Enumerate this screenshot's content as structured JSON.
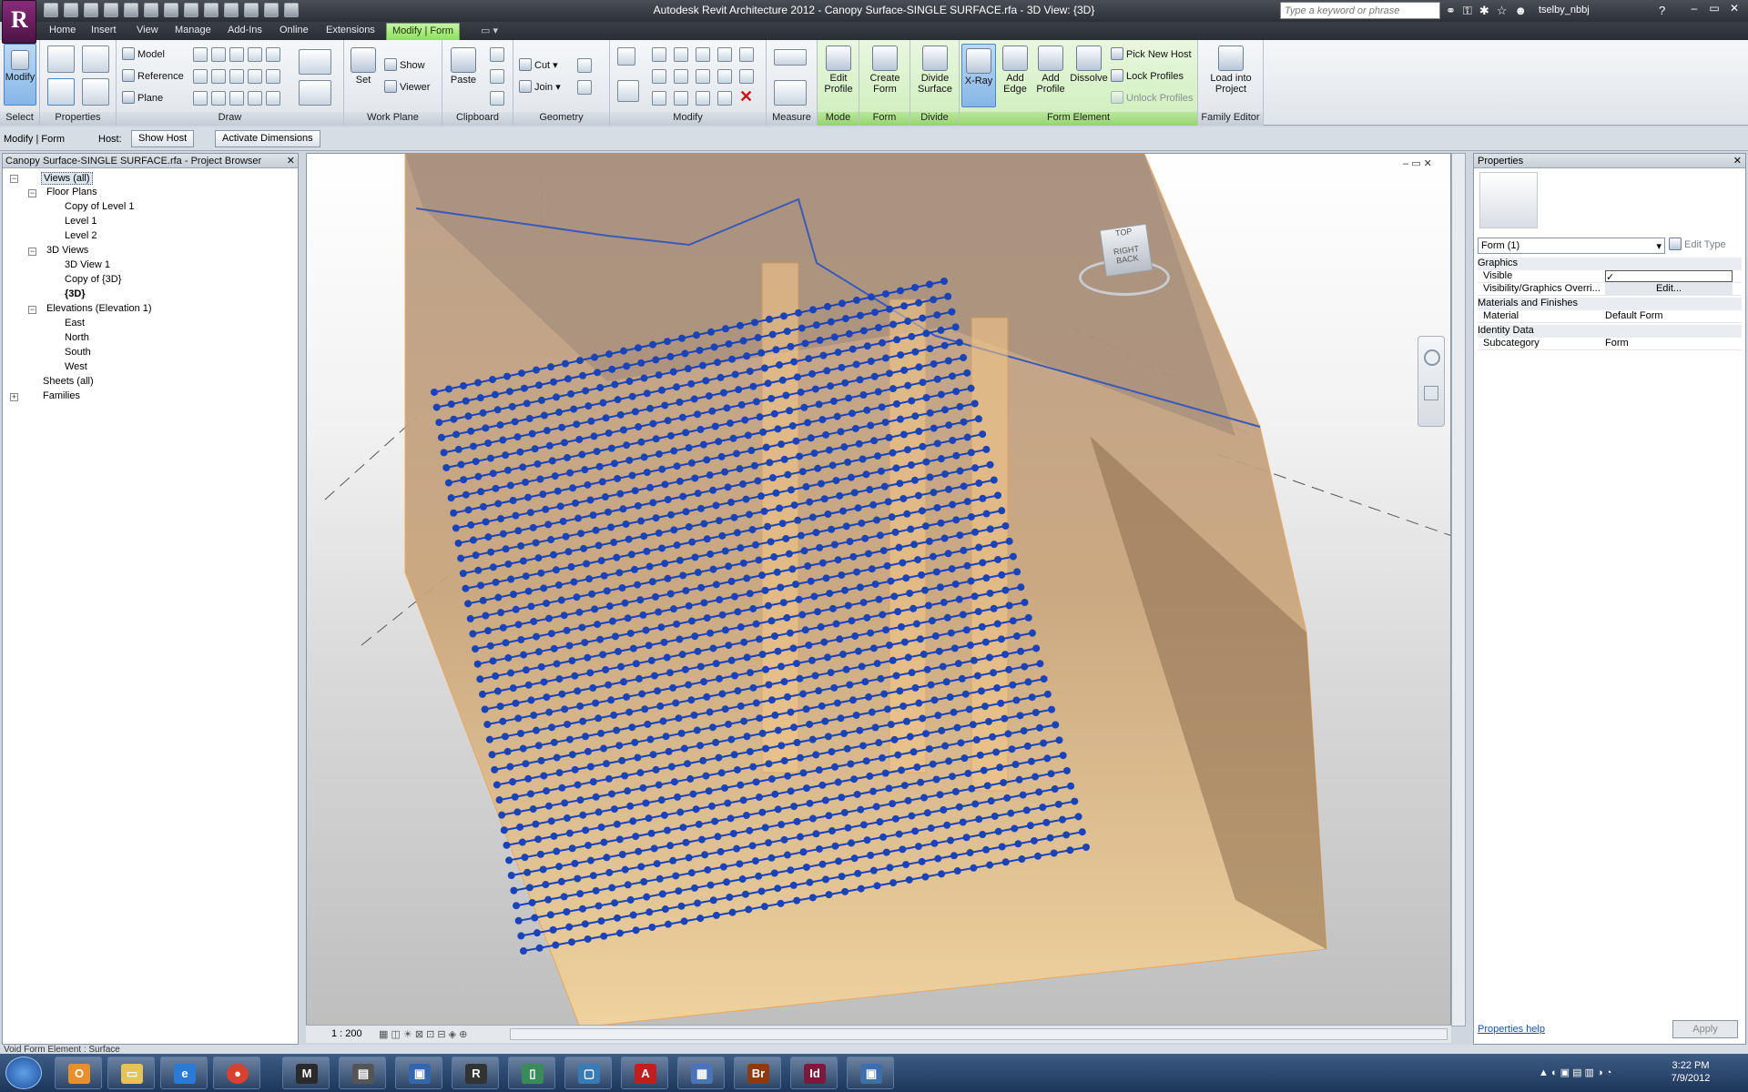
{
  "title_bar": {
    "app_button": "R",
    "title": "Autodesk Revit Architecture 2012 -  Canopy Surface-SINGLE SURFACE.rfa - 3D View: {3D}",
    "search_placeholder": "Type a keyword or phrase",
    "username": "tselby_nbbj",
    "help": "?",
    "minimize": "–",
    "restore": "▭",
    "close": "✕"
  },
  "tabs": [
    "Home",
    "Insert",
    "View",
    "Manage",
    "Add-Ins",
    "Online",
    "Extensions",
    "Modify | Form"
  ],
  "active_tab": "Modify | Form",
  "ribbon": {
    "panels": {
      "select": "Select",
      "properties": "Properties",
      "draw": "Draw",
      "work_plane": "Work Plane",
      "clipboard": "Clipboard",
      "geometry": "Geometry",
      "modify": "Modify",
      "measure": "Measure",
      "mode": "Mode",
      "form": "Form",
      "divide": "Divide",
      "form_element": "Form Element",
      "family_editor": "Family Editor"
    },
    "buttons": {
      "modify": "Modify",
      "model": "Model",
      "reference": "Reference",
      "plane": "Plane",
      "set": "Set",
      "show": "Show",
      "viewer": "Viewer",
      "paste": "Paste",
      "cut": "Cut",
      "join": "Join",
      "edit_profile": "Edit Profile",
      "create_form": "Create Form",
      "divide_surface": "Divide Surface",
      "x_ray": "X-Ray",
      "add_edge": "Add Edge",
      "add_profile": "Add Profile",
      "dissolve": "Dissolve",
      "pick_new_host": "Pick New Host",
      "lock_profiles": "Lock Profiles",
      "unlock_profiles": "Unlock Profiles",
      "load_into_project": "Load into Project"
    }
  },
  "options_bar": {
    "context": "Modify | Form",
    "host_label": "Host:",
    "show_host": "Show Host",
    "activate_dimensions": "Activate Dimensions"
  },
  "project_browser": {
    "title": "Canopy Surface-SINGLE SURFACE.rfa - Project Browser",
    "nodes": {
      "views_all": "Views (all)",
      "floor_plans": "Floor Plans",
      "copy_of_level_1": "Copy of Level 1",
      "level_1": "Level 1",
      "level_2": "Level 2",
      "views_3d": "3D Views",
      "view_3d_1": "3D View 1",
      "copy_of_3d": "Copy of {3D}",
      "view_3d": "{3D}",
      "elevations": "Elevations (Elevation 1)",
      "east": "East",
      "north": "North",
      "south": "South",
      "west": "West",
      "sheets_all": "Sheets (all)",
      "families": "Families"
    }
  },
  "viewport": {
    "scale": "1 : 200",
    "viewcube_right": "RIGHT",
    "viewcube_back": "BACK",
    "viewcube_top": "TOP"
  },
  "properties": {
    "title": "Properties",
    "type_selector": "Form (1)",
    "edit_type": "Edit Type",
    "categories": {
      "graphics": "Graphics",
      "materials": "Materials and Finishes",
      "identity": "Identity Data"
    },
    "rows": {
      "visible_label": "Visible",
      "visibility_label": "Visibility/Graphics Overri...",
      "visibility_value": "Edit...",
      "material_label": "Material",
      "material_value": "Default Form",
      "subcategory_label": "Subcategory",
      "subcategory_value": "Form"
    },
    "help": "Properties help",
    "apply": "Apply"
  },
  "status_bar": {
    "text": "Void Form Element : Surface"
  },
  "taskbar": {
    "apps": [
      "Start",
      "Outlook",
      "Explorer",
      "Internet Explorer",
      "Chrome",
      "3ds Max",
      "Maya",
      "Remote",
      "Revit",
      "Notepad",
      "Network",
      "Acrobat",
      "Control Panel",
      "Bridge",
      "InDesign",
      "Photos"
    ],
    "labels": {
      "bridge": "Br",
      "indesign": "Id",
      "acrobat": "A"
    },
    "time": "3:22 PM",
    "date": "7/9/2012"
  },
  "colors": {
    "accent_green": "#97d46f",
    "canopy_orange": "#f0c78a",
    "node_blue": "#1b43b8",
    "title_bar": "#2c3037"
  }
}
